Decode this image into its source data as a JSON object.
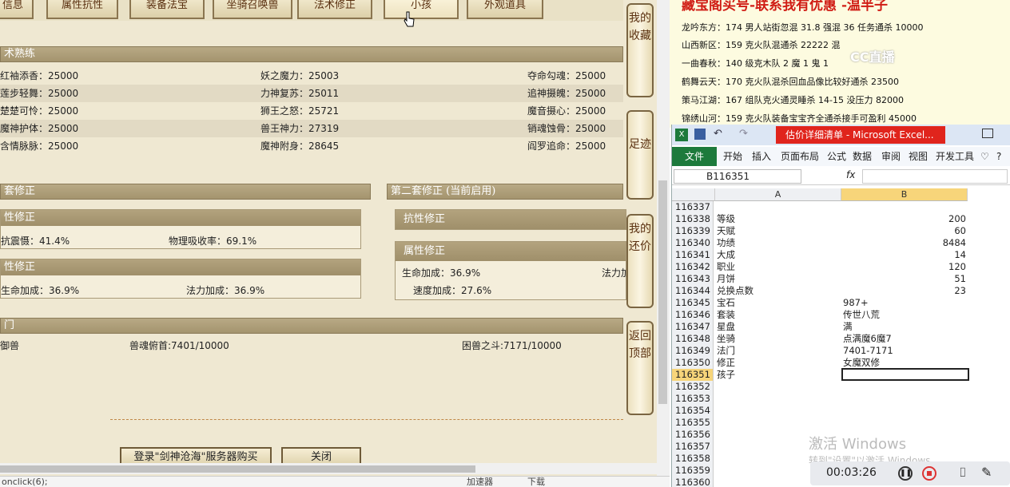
{
  "tabs": [
    "信息",
    "属性抗性",
    "装备法宝",
    "坐骑召唤兽",
    "法术修正",
    "小孩",
    "外观道具"
  ],
  "sections": {
    "skill": "术熟练",
    "set1": "套修正",
    "set2": "第二套修正 (当前启用)",
    "magic": "门"
  },
  "skill_rows": [
    [
      "红袖添香：25000",
      "妖之魔力：25003",
      "夺命勾魂：25000"
    ],
    [
      "莲步轻舞：25000",
      "力神复苏：25011",
      "追神摄魄：25000"
    ],
    [
      "楚楚可怜：25000",
      "狮王之怒：25721",
      "魔音摄心：25000"
    ],
    [
      "魔神护体：25000",
      "兽王神力：27319",
      "销魂蚀骨：25000"
    ],
    [
      "含情脉脉：25000",
      "魔神附身：28645",
      "阎罗追命：25000"
    ]
  ],
  "set1": {
    "resist_hdr": "性修正",
    "resist_a": "抗震慑：41.4%",
    "resist_b": "物理吸收率：69.1%",
    "attr_hdr": "性修正",
    "attr_a": "生命加成：36.9%",
    "attr_b": "法力加成：36.9%"
  },
  "set2": {
    "resist_hdr": "抗性修正",
    "attr_hdr": "属性修正",
    "attr_a": "生命加成：36.9%",
    "attr_b": "法力加",
    "attr_c": "速度加成：27.6%"
  },
  "magic_row": [
    "御兽",
    "兽魂俯首:7401/10000",
    "困兽之斗:7171/10000"
  ],
  "side_buttons": [
    "我的收藏",
    "足迹",
    "我的还价",
    "返回顶部"
  ],
  "bottom_buttons": [
    "登录\"剑神沧海\"服务器购买",
    "关闭"
  ],
  "status": "onclick(6);",
  "status_right": [
    "加速器",
    "下载"
  ],
  "notes": {
    "title": "藏宝阁买号-联系我有优惠 -温半子",
    "lines": [
      "龙吟东方：174 男人站街忽混 31.8 强混 36 任务通杀 10000",
      "山西新区：159 克火队混通杀 22222 混",
      "一曲春秋：140 级克木队 2 魔 1 鬼 1",
      "鹤舞云天：170 克火队混杀回血品像比较好通杀 23500",
      "策马江湖：167 组队克火通灵睡杀 14-15 没压力 82000",
      "锦绣山河：159 克火队装备宝宝齐全通杀接手可盈利 45000"
    ]
  },
  "watermark": "CC直播",
  "excel": {
    "title": "估价详细清单 - Microsoft Excel...",
    "file": "文件",
    "ribbon": [
      "开始",
      "插入",
      "页面布局",
      "公式",
      "数据",
      "审阅",
      "视图",
      "开发工具"
    ],
    "namebox": "B116351",
    "fx": "fx",
    "cols": [
      "A",
      "B"
    ],
    "rows": [
      [
        "116337",
        "",
        ""
      ],
      [
        "116338",
        "等级",
        "200"
      ],
      [
        "116339",
        "天赋",
        "60"
      ],
      [
        "116340",
        "功绩",
        "8484"
      ],
      [
        "116341",
        "大成",
        "14"
      ],
      [
        "116342",
        "职业",
        "120"
      ],
      [
        "116343",
        "月饼",
        "51"
      ],
      [
        "116344",
        "兑换点数",
        "23"
      ],
      [
        "116345",
        "宝石",
        "987+"
      ],
      [
        "116346",
        "套装",
        "传世八荒"
      ],
      [
        "116347",
        "星盘",
        "满"
      ],
      [
        "116348",
        "坐骑",
        "点满魔6魔7"
      ],
      [
        "116349",
        "法门",
        "7401-7171"
      ],
      [
        "116350",
        "修正",
        "女魔双修"
      ],
      [
        "116351",
        "孩子",
        ""
      ],
      [
        "116352",
        "",
        ""
      ],
      [
        "116353",
        "",
        ""
      ],
      [
        "116354",
        "",
        ""
      ],
      [
        "116355",
        "",
        ""
      ],
      [
        "116356",
        "",
        ""
      ],
      [
        "116357",
        "",
        ""
      ],
      [
        "116358",
        "",
        ""
      ],
      [
        "116359",
        "",
        ""
      ],
      [
        "116360",
        "",
        ""
      ]
    ]
  },
  "activate": {
    "line1": "激活 Windows",
    "line2": "转到\"设置\"以激活 Windows。"
  },
  "recorder": {
    "time": "00:03:26"
  }
}
